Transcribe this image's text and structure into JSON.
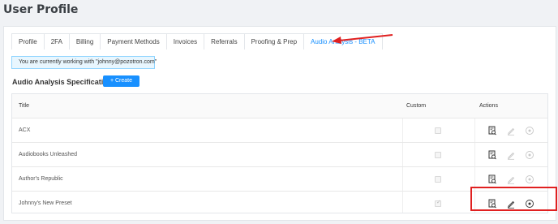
{
  "page": {
    "title": "User Profile"
  },
  "tabs": [
    {
      "label": "Profile",
      "active": false
    },
    {
      "label": "2FA",
      "active": false
    },
    {
      "label": "Billing",
      "active": false
    },
    {
      "label": "Payment Methods",
      "active": false
    },
    {
      "label": "Invoices",
      "active": false
    },
    {
      "label": "Referrals",
      "active": false
    },
    {
      "label": "Proofing & Prep",
      "active": false
    },
    {
      "label": "Audio Analysis - BETA",
      "active": true
    }
  ],
  "notice": {
    "text": "You are currently working with \"johnny@pozotron.com\""
  },
  "section": {
    "title": "Audio Analysis Specifications",
    "create_label": "+ Create"
  },
  "table": {
    "headers": {
      "title": "Title",
      "custom": "Custom",
      "actions": "Actions"
    },
    "rows": [
      {
        "title": "ACX",
        "custom": false,
        "editable": false
      },
      {
        "title": "Audiobooks Unleashed",
        "custom": false,
        "editable": false
      },
      {
        "title": "Author's Republic",
        "custom": false,
        "editable": false
      },
      {
        "title": "Johnny's New Preset",
        "custom": true,
        "editable": true
      }
    ]
  },
  "colors": {
    "accent": "#1890ff",
    "annotation": "#e02020",
    "disabled": "#c8c8c8",
    "enabled": "#333333"
  },
  "icons": {
    "view": "document-view-icon",
    "edit": "pencil-icon",
    "delete": "circle-delete-icon"
  }
}
